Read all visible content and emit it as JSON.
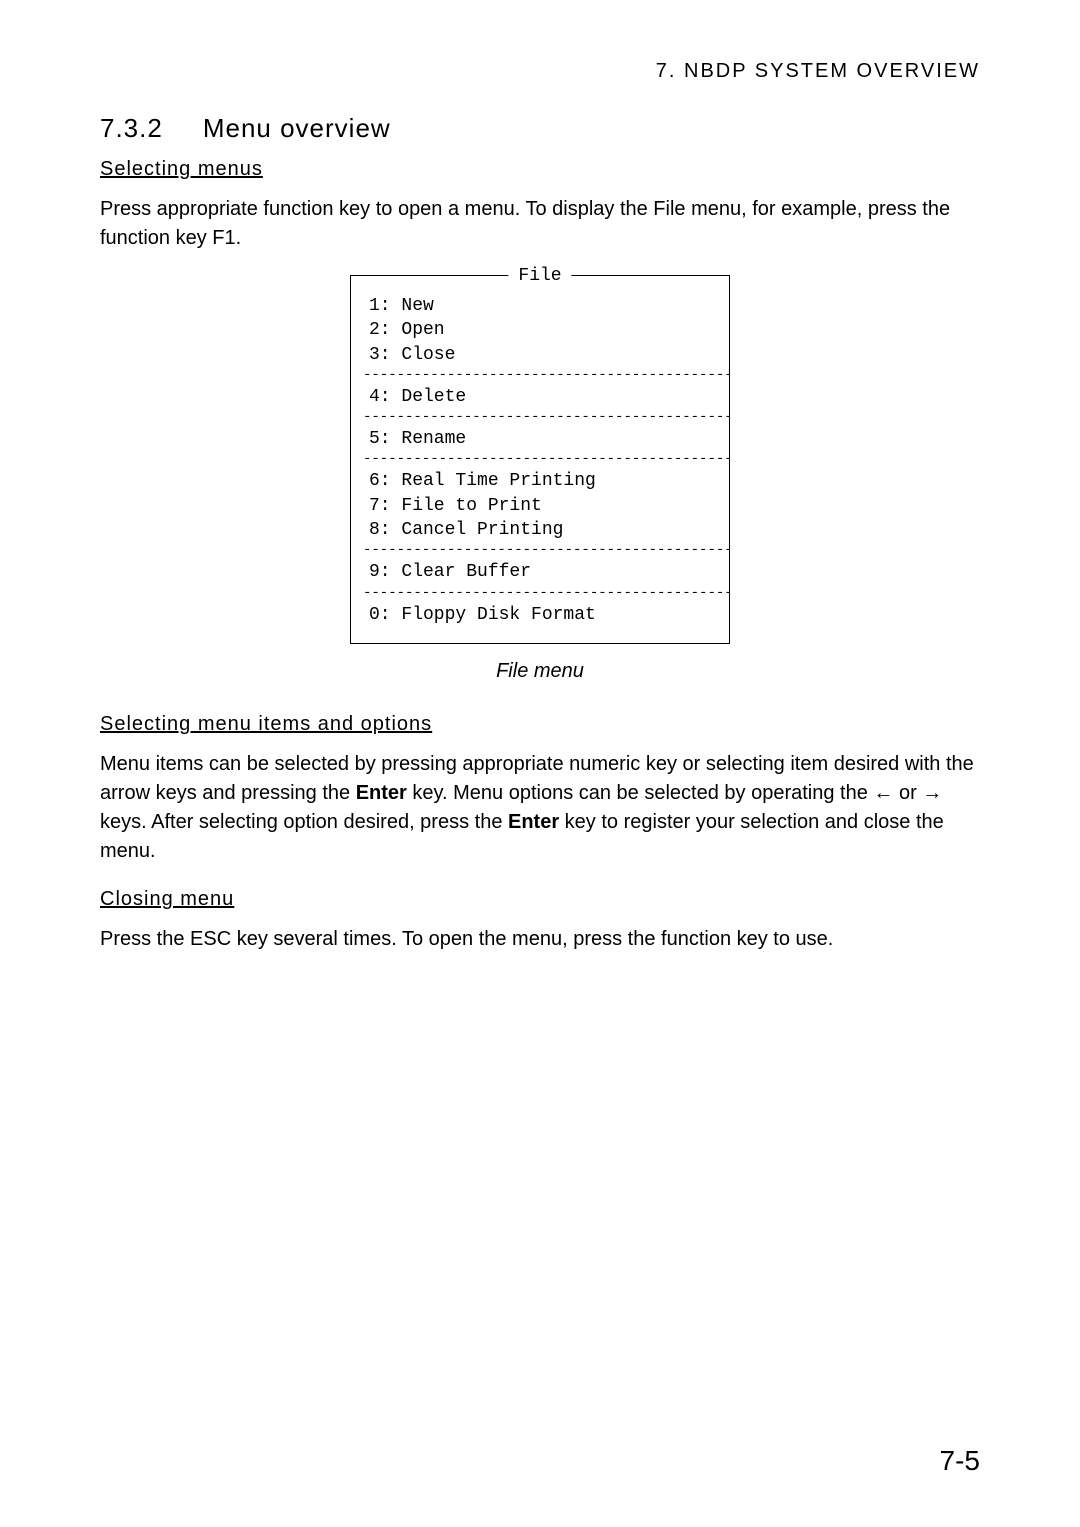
{
  "header": "7. NBDP SYSTEM OVERVIEW",
  "section": {
    "number": "7.3.2",
    "title": "Menu overview"
  },
  "sub1": {
    "heading": "Selecting menus",
    "text": "Press appropriate function key to open a menu. To display the File menu, for example, press the function key F1."
  },
  "menu": {
    "title": "File",
    "group1": {
      "i1": "1: New",
      "i2": "2: Open",
      "i3": "3: Close"
    },
    "group2": {
      "i1": "4: Delete"
    },
    "group3": {
      "i1": "5: Rename"
    },
    "group4": {
      "i1": "6: Real Time Printing",
      "i2": "7: File to Print",
      "i3": "8: Cancel Printing"
    },
    "group5": {
      "i1": "9: Clear Buffer"
    },
    "group6": {
      "i1": "0: Floppy Disk Format"
    },
    "sep": "-------------------------------------------------"
  },
  "caption": "File menu",
  "sub2": {
    "heading": "Selecting menu items and options",
    "part1": "Menu items can be selected by pressing appropriate numeric key or selecting item desired with the arrow keys and pressing the ",
    "enter1": "Enter",
    "part2": " key. Menu options can be selected by operating the ← or → keys. After selecting option desired, press the ",
    "enter2": "Enter",
    "part3": " key to register your selection and close the menu."
  },
  "sub3": {
    "heading": "Closing menu",
    "text": "Press the ESC key several times. To open the menu, press the function key to use."
  },
  "pageNumber": "7-5"
}
